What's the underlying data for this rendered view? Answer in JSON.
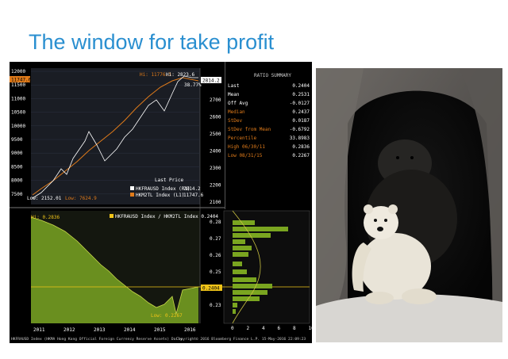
{
  "slide": {
    "title": "The window for take profit"
  },
  "colors": {
    "title": "#2a8fd0",
    "hkd": "#ffffff",
    "hkm2": "#e07b1a",
    "ratio_fill": "#7aa520",
    "ratio_line": "#c8d84a",
    "accent": "#f0c419"
  },
  "terminal": {
    "top_chart": {
      "y_left_ticks": [
        "12000",
        "11500",
        "11000",
        "10500",
        "10000",
        "9500",
        "9000",
        "8500",
        "8000",
        "7500"
      ],
      "y_right_ticks": [
        "2700",
        "2600",
        "2500",
        "2400",
        "2300",
        "2200",
        "2100"
      ],
      "hi_label": "Hi: 11776.3",
      "hi2_label": "Hi: 2823.6",
      "pct_label": "38.77%",
      "low_left_label": "Low: 2152.01",
      "low_right_label": "Low: 7624.9",
      "badge_left": "11747.6",
      "badge_right": "2814.2",
      "legend_title": "Last Price",
      "legend_items": [
        {
          "label": "HKFRAUSD Index (R1)",
          "value": "2814.2",
          "color": "#ffffff"
        },
        {
          "label": "HKM2TL Index (L1)",
          "value": "11747.6",
          "color": "#e07b1a"
        }
      ]
    },
    "ratio_summary": {
      "header": "RATIO SUMMARY",
      "rows": [
        {
          "k": "Last",
          "v": "0.2404",
          "c": "#ffffff"
        },
        {
          "k": "Mean",
          "v": "0.2531",
          "c": "#ffffff"
        },
        {
          "k": "Off Avg",
          "v": "-0.0127",
          "c": "#ffffff"
        },
        {
          "k": "Median",
          "v": "0.2437",
          "c": "#e07b1a"
        },
        {
          "k": "StDev",
          "v": "0.0187",
          "c": "#e07b1a"
        },
        {
          "k": "StDev from Mean",
          "v": "-0.6792",
          "c": "#e07b1a"
        },
        {
          "k": "Percentile",
          "v": "33.8983",
          "c": "#e07b1a"
        },
        {
          "k": "High 06/30/11",
          "v": "0.2836",
          "c": "#e07b1a"
        },
        {
          "k": "Low 08/31/15",
          "v": "0.2267",
          "c": "#e07b1a"
        }
      ]
    },
    "bottom_chart": {
      "legend": "HKFRAUSD Index / HKM2TL Index  0.2404",
      "hi_label": "Hi: 0.2836",
      "low_label": "Low: 0.2267",
      "y_ticks": [
        "0.28",
        "0.27",
        "0.26",
        "0.25",
        "0.24",
        "0.23"
      ],
      "last_badge": "0.2404",
      "hist_x_ticks": [
        "0",
        "2",
        "4",
        "6",
        "8",
        "10"
      ],
      "x_ticks": [
        "2011",
        "2012",
        "2013",
        "2014",
        "2015",
        "2016"
      ],
      "footer_left": "HKFRAUSD Index (HKMA Hong Kong Official Foreign Currency Reserve Assets)  Daily",
      "footer_right": "Copyright© 2016 Bloomberg Finance L.P.     15-May-2016 22:09:23"
    }
  },
  "photo": {
    "subject": "polar bear cub in cave entrance"
  }
}
